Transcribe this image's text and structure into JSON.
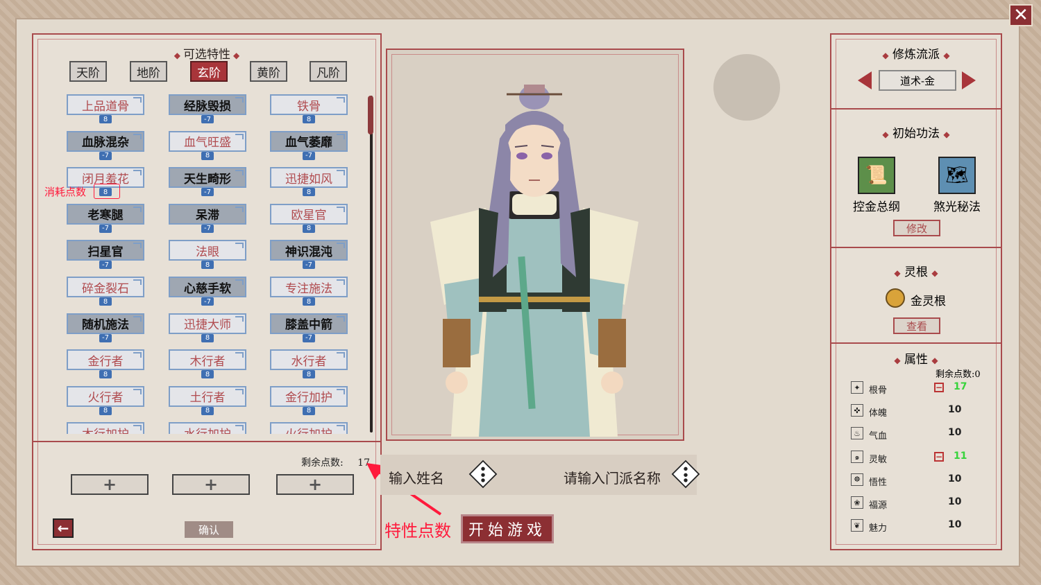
{
  "close_label": "✕",
  "traits_panel": {
    "title": "可选特性",
    "tiers": [
      "天阶",
      "地阶",
      "玄阶",
      "黄阶",
      "凡阶"
    ],
    "active_tier": "玄阶",
    "traits": [
      {
        "name": "上品道骨",
        "cost": "8",
        "kind": "good"
      },
      {
        "name": "经脉毁损",
        "cost": "-7",
        "kind": "bad"
      },
      {
        "name": "铁骨",
        "cost": "8",
        "kind": "good"
      },
      {
        "name": "血脉混杂",
        "cost": "-7",
        "kind": "bad"
      },
      {
        "name": "血气旺盛",
        "cost": "8",
        "kind": "good"
      },
      {
        "name": "血气萎靡",
        "cost": "-7",
        "kind": "bad"
      },
      {
        "name": "闭月羞花",
        "cost": "8",
        "kind": "good"
      },
      {
        "name": "天生畸形",
        "cost": "-7",
        "kind": "bad"
      },
      {
        "name": "迅捷如风",
        "cost": "8",
        "kind": "good"
      },
      {
        "name": "老寒腿",
        "cost": "-7",
        "kind": "bad"
      },
      {
        "name": "呆滞",
        "cost": "-7",
        "kind": "bad"
      },
      {
        "name": "欧星官",
        "cost": "8",
        "kind": "good"
      },
      {
        "name": "扫星官",
        "cost": "-7",
        "kind": "bad"
      },
      {
        "name": "法眼",
        "cost": "8",
        "kind": "good"
      },
      {
        "name": "神识混沌",
        "cost": "-7",
        "kind": "bad"
      },
      {
        "name": "碎金裂石",
        "cost": "8",
        "kind": "good"
      },
      {
        "name": "心慈手软",
        "cost": "-7",
        "kind": "bad"
      },
      {
        "name": "专注施法",
        "cost": "8",
        "kind": "good"
      },
      {
        "name": "随机施法",
        "cost": "-7",
        "kind": "bad"
      },
      {
        "name": "迅捷大师",
        "cost": "8",
        "kind": "good"
      },
      {
        "name": "膝盖中箭",
        "cost": "-7",
        "kind": "bad"
      },
      {
        "name": "金行者",
        "cost": "8",
        "kind": "good"
      },
      {
        "name": "木行者",
        "cost": "8",
        "kind": "good"
      },
      {
        "name": "水行者",
        "cost": "8",
        "kind": "good"
      },
      {
        "name": "火行者",
        "cost": "8",
        "kind": "good"
      },
      {
        "name": "土行者",
        "cost": "8",
        "kind": "good"
      },
      {
        "name": "金行加护",
        "cost": "8",
        "kind": "good"
      },
      {
        "name": "木行加护",
        "cost": "",
        "kind": "good"
      },
      {
        "name": "水行加护",
        "cost": "",
        "kind": "good"
      },
      {
        "name": "火行加护",
        "cost": "",
        "kind": "good"
      }
    ],
    "remaining_label": "剩余点数:",
    "remaining_value": "17",
    "slot_symbol": "+",
    "confirm_label": "确认",
    "back_symbol": "←"
  },
  "annotations": {
    "cost_note": "消耗点数",
    "points_note": "特性点数"
  },
  "name_bar": {
    "name_placeholder": "输入姓名",
    "sect_placeholder": "请输入门派名称"
  },
  "start_label": "开始游戏",
  "right_panel": {
    "school_title": "修炼流派",
    "school_value": "道术-金",
    "skills_title": "初始功法",
    "skills": [
      {
        "name": "控金总纲",
        "icon": "scroll-icon"
      },
      {
        "name": "煞光秘法",
        "icon": "map-scroll-icon"
      }
    ],
    "modify_label": "修改",
    "root_title": "灵根",
    "root_value": "金灵根",
    "view_label": "查看",
    "attr_title": "属性",
    "attr_remaining": "剩余点数:0",
    "attributes": [
      {
        "name": "根骨",
        "value": "17",
        "modified": true,
        "icon": "✦"
      },
      {
        "name": "体魄",
        "value": "10",
        "modified": false,
        "icon": "✜"
      },
      {
        "name": "气血",
        "value": "10",
        "modified": false,
        "icon": "♨"
      },
      {
        "name": "灵敏",
        "value": "11",
        "modified": true,
        "icon": "๑"
      },
      {
        "name": "悟性",
        "value": "10",
        "modified": false,
        "icon": "☸"
      },
      {
        "name": "福源",
        "value": "10",
        "modified": false,
        "icon": "❀"
      },
      {
        "name": "魅力",
        "value": "10",
        "modified": false,
        "icon": "❦"
      }
    ]
  },
  "colors": {
    "accent": "#a94a4c",
    "good_text": "#b04a4e",
    "green": "#36d33a",
    "cost_badge": "#3f6fb2"
  }
}
